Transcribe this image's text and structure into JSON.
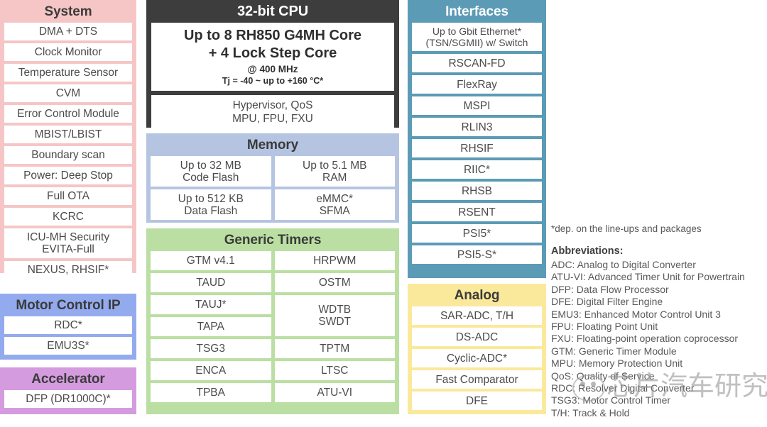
{
  "system": {
    "title": "System",
    "items": [
      "DMA + DTS",
      "Clock Monitor",
      "Temperature Sensor",
      "CVM",
      "Error Control Module",
      "MBIST/LBIST",
      "Boundary scan",
      "Power: Deep Stop",
      "Full OTA",
      "KCRC",
      "ICU-MH Security\nEVITA-Full",
      "NEXUS, RHSIF*"
    ]
  },
  "motor_control": {
    "title": "Motor Control IP",
    "items": [
      "RDC*",
      "EMU3S*"
    ]
  },
  "accelerator": {
    "title": "Accelerator",
    "items": [
      "DFP (DR1000C)*"
    ]
  },
  "cpu": {
    "title": "32-bit CPU",
    "core_line1": "Up to 8 RH850 G4MH Core",
    "core_line2": "+ 4 Lock Step Core",
    "core_line3": "@ 400 MHz",
    "core_line4": "Tj = -40 ~  up to +160 °C*",
    "hypervisor_line1": "Hypervisor, QoS",
    "hypervisor_line2": "MPU, FPU, FXU"
  },
  "memory": {
    "title": "Memory",
    "items": [
      "Up to 32 MB\nCode Flash",
      "Up to 5.1 MB\nRAM",
      "Up to 512 KB\nData Flash",
      "eMMC*\nSFMA"
    ]
  },
  "timers": {
    "title": "Generic Timers",
    "left_items": [
      "GTM v4.1",
      "TAUD",
      "TAUJ*",
      "TAPA",
      "TSG3",
      "ENCA",
      "TPBA"
    ],
    "right_items": [
      "HRPWM",
      "OSTM",
      "WDTB\nSWDT",
      "TPTM",
      "LTSC",
      "ATU-VI"
    ]
  },
  "interfaces": {
    "title": "Interfaces",
    "items": [
      "Up to Gbit Ethernet*\n(TSN/SGMII) w/ Switch",
      "RSCAN-FD",
      "FlexRay",
      "MSPI",
      "RLIN3",
      "RHSIF",
      "RIIC*",
      "RHSB",
      "RSENT",
      "PSI5*",
      "PSI5-S*"
    ]
  },
  "analog": {
    "title": "Analog",
    "items": [
      "SAR-ADC, T/H",
      "DS-ADC",
      "Cyclic-ADC*",
      "Fast Comparator",
      "DFE"
    ]
  },
  "notes": {
    "footnote": "*dep. on the line-ups and packages",
    "abbreviations_title": "Abbreviations:",
    "abbreviations": [
      "ADC: Analog to Digital Converter",
      "ATU-VI: Advanced Timer Unit for Powertrain",
      "DFP: Data Flow Processor",
      "DFE: Digital Filter Engine",
      "EMU3: Enhanced Motor Control Unit 3",
      "FPU: Floating Point Unit",
      "FXU: Floating-point operation coprocessor",
      "GTM: Generic Timer Module",
      "MPU: Memory Protection Unit",
      "QoS: Quality of Service",
      "RDC: Resolver Digital Converter",
      "TSG3: Motor Control Timer",
      "T/H: Track & Hold"
    ]
  },
  "watermark": {
    "text": "芯片汽车研究"
  },
  "colors": {
    "system": "#f6c6c6",
    "motor_control": "#93abee",
    "accelerator": "#d59bdf",
    "cpu": "#3d3d3d",
    "memory": "#b5c5e1",
    "timers": "#bbdfa3",
    "interfaces": "#5c9bb6",
    "analog": "#fbe99b"
  }
}
